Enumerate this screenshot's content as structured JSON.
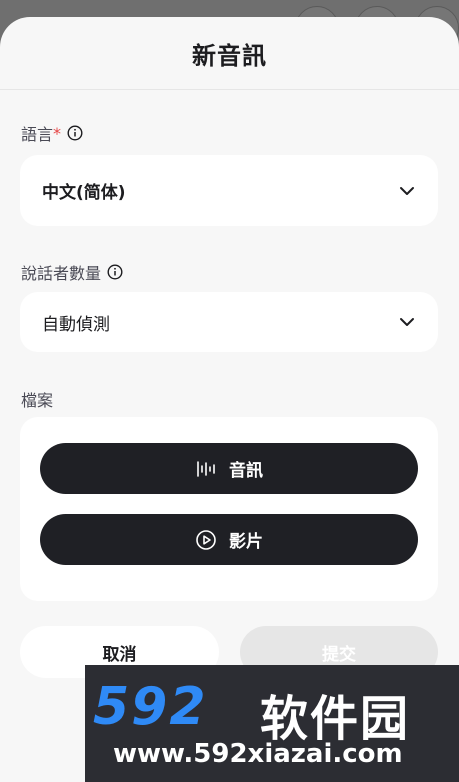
{
  "header": {
    "title": "新音訊"
  },
  "language": {
    "label": "語言",
    "required_mark": "*",
    "value": "中文(简体)"
  },
  "speakers": {
    "label": "說話者數量",
    "value": "自動偵測"
  },
  "files": {
    "label": "檔案",
    "audio_button": "音訊",
    "video_button": "影片"
  },
  "actions": {
    "cancel": "取消",
    "submit": "提交"
  },
  "watermark": {
    "logo": "592",
    "name": "软件园",
    "url": "www.592xiazai.com"
  },
  "colors": {
    "dark_button": "#1f2025",
    "sheet_bg": "#f7f7f7",
    "required": "#e64545",
    "watermark_blue": "#2f8af6"
  }
}
